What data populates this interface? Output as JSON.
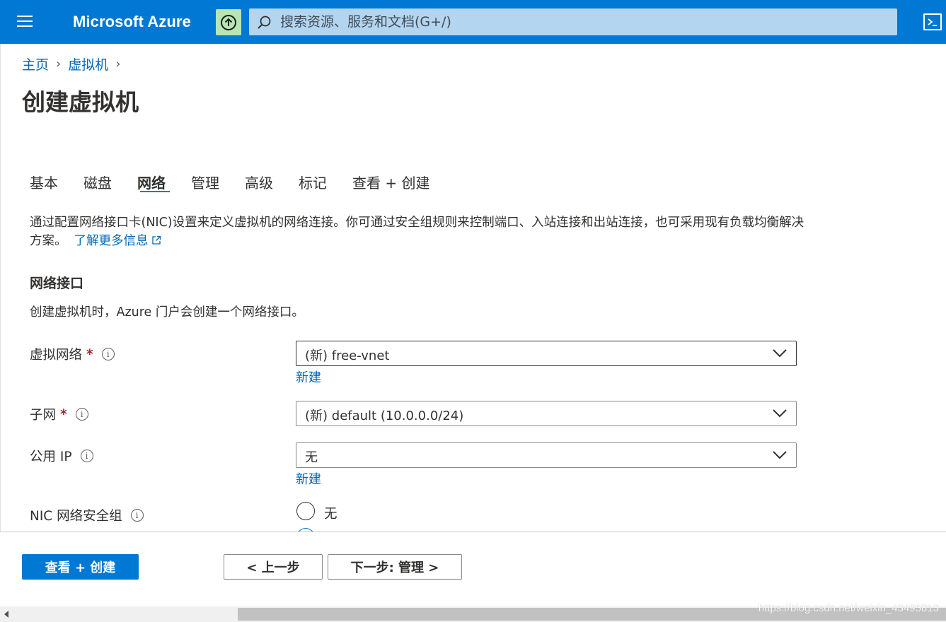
{
  "header": {
    "brand": "Microsoft Azure",
    "search_placeholder": "搜索资源、服务和文档(G+/)",
    "colors": {
      "bar": "#0078d4",
      "upload_button": "#b7e6b4",
      "search_bg": "#b3d5f0"
    }
  },
  "breadcrumb": [
    {
      "label": "主页"
    },
    {
      "label": "虚拟机"
    }
  ],
  "page_title": "创建虚拟机",
  "tabs": [
    {
      "label": "基本",
      "active": false
    },
    {
      "label": "磁盘",
      "active": false
    },
    {
      "label": "网络",
      "active": true
    },
    {
      "label": "管理",
      "active": false
    },
    {
      "label": "高级",
      "active": false
    },
    {
      "label": "标记",
      "active": false
    },
    {
      "label": "查看 + 创建",
      "active": false
    }
  ],
  "description": {
    "text": "通过配置网络接口卡(NIC)设置来定义虚拟机的网络连接。你可通过安全组规则来控制端口、入站连接和出站连接，也可采用现有负载均衡解决方案。",
    "link": "了解更多信息"
  },
  "section": {
    "title": "网络接口",
    "subtitle": "创建虚拟机时，Azure 门户会创建一个网络接口。"
  },
  "fields": {
    "vnet": {
      "label": "虚拟网络",
      "required": "*",
      "value": "(新) free-vnet",
      "new_link": "新建"
    },
    "subnet": {
      "label": "子网",
      "required": "*",
      "value": "(新) default (10.0.0.0/24)"
    },
    "public_ip": {
      "label": "公用 IP",
      "value": "无",
      "new_link": "新建"
    },
    "nsg": {
      "label": "NIC 网络安全组",
      "option_none": "无"
    }
  },
  "footer": {
    "review_create": "查看 + 创建",
    "previous": "< 上一步",
    "next": "下一步: 管理 >"
  },
  "watermark": "https://blog.csdn.net/weixin_43495813"
}
